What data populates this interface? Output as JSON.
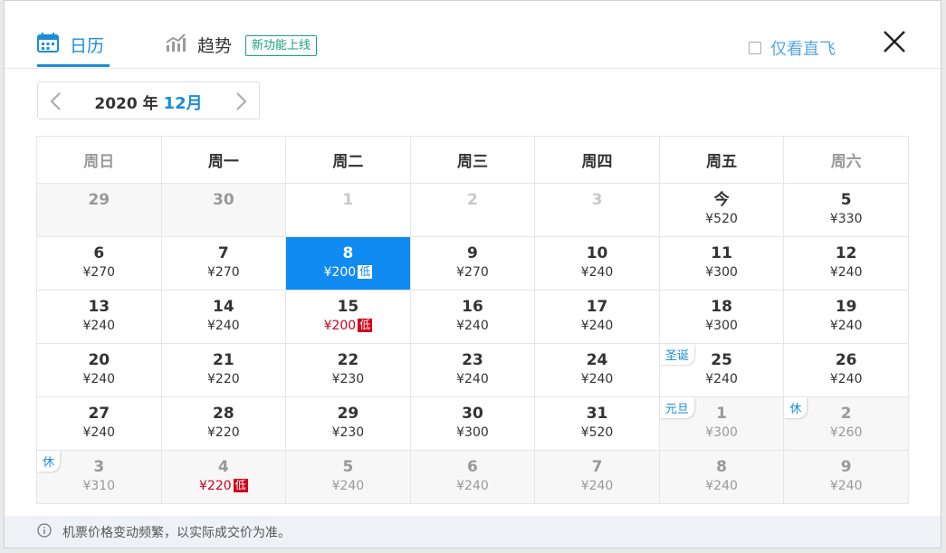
{
  "tabs": {
    "calendar": "日历",
    "trend": "趋势",
    "new_badge": "新功能上线"
  },
  "direct_only": "仅看直飞",
  "month_nav": {
    "year": "2020",
    "year_unit": "年",
    "month": "12月"
  },
  "weekdays": [
    "周日",
    "周一",
    "周二",
    "周三",
    "周四",
    "周五",
    "周六"
  ],
  "weeks": [
    [
      {
        "day": "29",
        "price": "",
        "state": "prev"
      },
      {
        "day": "30",
        "price": "",
        "state": "prev"
      },
      {
        "day": "1",
        "price": "",
        "state": "past"
      },
      {
        "day": "2",
        "price": "",
        "state": "past"
      },
      {
        "day": "3",
        "price": "",
        "state": "past"
      },
      {
        "day": "今",
        "price": "¥520"
      },
      {
        "day": "5",
        "price": "¥330"
      }
    ],
    [
      {
        "day": "6",
        "price": "¥270"
      },
      {
        "day": "7",
        "price": "¥270"
      },
      {
        "day": "8",
        "price": "¥200",
        "low": "低",
        "state": "selected"
      },
      {
        "day": "9",
        "price": "¥270"
      },
      {
        "day": "10",
        "price": "¥240"
      },
      {
        "day": "11",
        "price": "¥300"
      },
      {
        "day": "12",
        "price": "¥240"
      }
    ],
    [
      {
        "day": "13",
        "price": "¥240"
      },
      {
        "day": "14",
        "price": "¥240"
      },
      {
        "day": "15",
        "price": "¥200",
        "low": "低",
        "red": true
      },
      {
        "day": "16",
        "price": "¥240"
      },
      {
        "day": "17",
        "price": "¥240"
      },
      {
        "day": "18",
        "price": "¥300"
      },
      {
        "day": "19",
        "price": "¥240"
      }
    ],
    [
      {
        "day": "20",
        "price": "¥240"
      },
      {
        "day": "21",
        "price": "¥220"
      },
      {
        "day": "22",
        "price": "¥230"
      },
      {
        "day": "23",
        "price": "¥240"
      },
      {
        "day": "24",
        "price": "¥240"
      },
      {
        "day": "25",
        "price": "¥240",
        "tag": "圣诞"
      },
      {
        "day": "26",
        "price": "¥240"
      }
    ],
    [
      {
        "day": "27",
        "price": "¥240"
      },
      {
        "day": "28",
        "price": "¥220"
      },
      {
        "day": "29",
        "price": "¥230"
      },
      {
        "day": "30",
        "price": "¥300"
      },
      {
        "day": "31",
        "price": "¥520"
      },
      {
        "day": "1",
        "price": "¥300",
        "state": "next",
        "tag": "元旦"
      },
      {
        "day": "2",
        "price": "¥260",
        "state": "next",
        "tag": "休"
      }
    ],
    [
      {
        "day": "3",
        "price": "¥310",
        "state": "next",
        "tag": "休"
      },
      {
        "day": "4",
        "price": "¥220",
        "low": "低",
        "red": true,
        "state": "next"
      },
      {
        "day": "5",
        "price": "¥240",
        "state": "next"
      },
      {
        "day": "6",
        "price": "¥240",
        "state": "next"
      },
      {
        "day": "7",
        "price": "¥240",
        "state": "next"
      },
      {
        "day": "8",
        "price": "¥240",
        "state": "next"
      },
      {
        "day": "9",
        "price": "¥240",
        "state": "next"
      }
    ]
  ],
  "footer_note": "机票价格变动频繁，以实际成交价为准。",
  "colors": {
    "accent": "#1a8dd8",
    "selected": "#0f8bf1",
    "low_red": "#d0021b",
    "badge_green": "#1aa37a"
  }
}
